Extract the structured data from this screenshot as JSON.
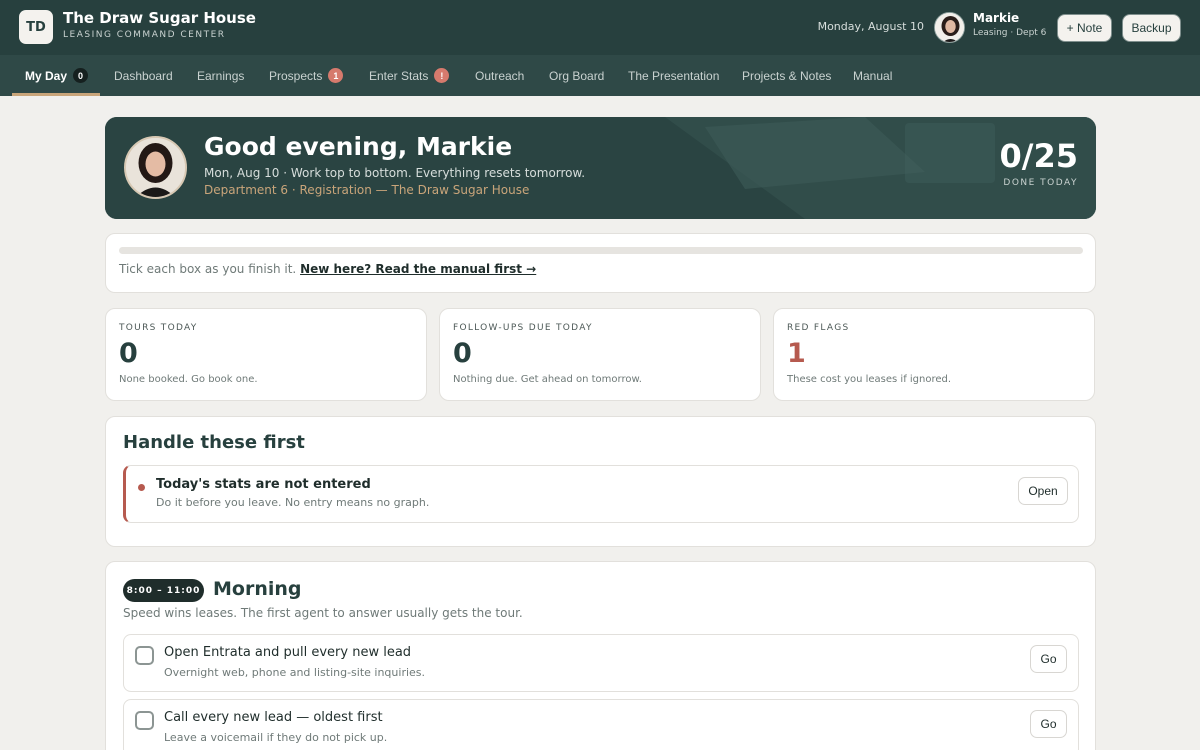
{
  "app": {
    "logo_initials": "TD",
    "title": "The Draw Sugar House",
    "subtitle": "LEASING COMMAND CENTER",
    "date": "Monday, August 10"
  },
  "user": {
    "name": "Markie",
    "role": "Leasing · Dept 6"
  },
  "header_buttons": {
    "note": "+ Note",
    "backup": "Backup"
  },
  "tabs": [
    {
      "label": "My Day",
      "count": "0",
      "active": true
    },
    {
      "label": "Dashboard"
    },
    {
      "label": "Earnings"
    },
    {
      "label": "Prospects",
      "count": "1"
    },
    {
      "label": "Enter Stats",
      "count": "!"
    },
    {
      "label": "Outreach"
    },
    {
      "label": "Org Board"
    },
    {
      "label": "The Presentation"
    },
    {
      "label": "Projects & Notes"
    },
    {
      "label": "Manual"
    }
  ],
  "hero": {
    "greeting": "Good evening, Markie",
    "line1": "Mon, Aug 10  ·  Work top to bottom. Everything resets tomorrow.",
    "line2": "Department 6 · Registration — The Draw Sugar House",
    "done": "0/25",
    "done_label": "DONE TODAY"
  },
  "progress": {
    "fraction": 0,
    "text": "Tick each box as you finish it.",
    "manual_link": "New here? Read the manual first →"
  },
  "stats": [
    {
      "label": "TOURS TODAY",
      "value": "0",
      "note": "None booked. Go book one."
    },
    {
      "label": "FOLLOW-UPS DUE TODAY",
      "value": "0",
      "note": "Nothing due. Get ahead on tomorrow."
    },
    {
      "label": "RED FLAGS",
      "value": "1",
      "note": "These cost you leases if ignored."
    }
  ],
  "handle": {
    "title": "Handle these first",
    "alert_title": "Today's stats are not entered",
    "alert_sub": "Do it before you leave. No entry means no graph.",
    "open": "Open"
  },
  "morning": {
    "time": "8:00 – 11:00",
    "title": "Morning",
    "subtitle": "Speed wins leases. The first agent to answer usually gets the tour.",
    "tasks": [
      {
        "title": "Open Entrata and pull every new lead",
        "sub": "Overnight web, phone and listing-site inquiries.",
        "button": "Go"
      },
      {
        "title": "Call every new lead — oldest first",
        "sub": "Leave a voicemail if they do not pick up.",
        "button": "Go"
      }
    ]
  },
  "colors": {
    "header": "#27403e",
    "tabbar": "#2f4947",
    "accent_gold": "#c9a57a",
    "red_flag": "#b65a4f",
    "page_bg": "#f1f0ed"
  }
}
